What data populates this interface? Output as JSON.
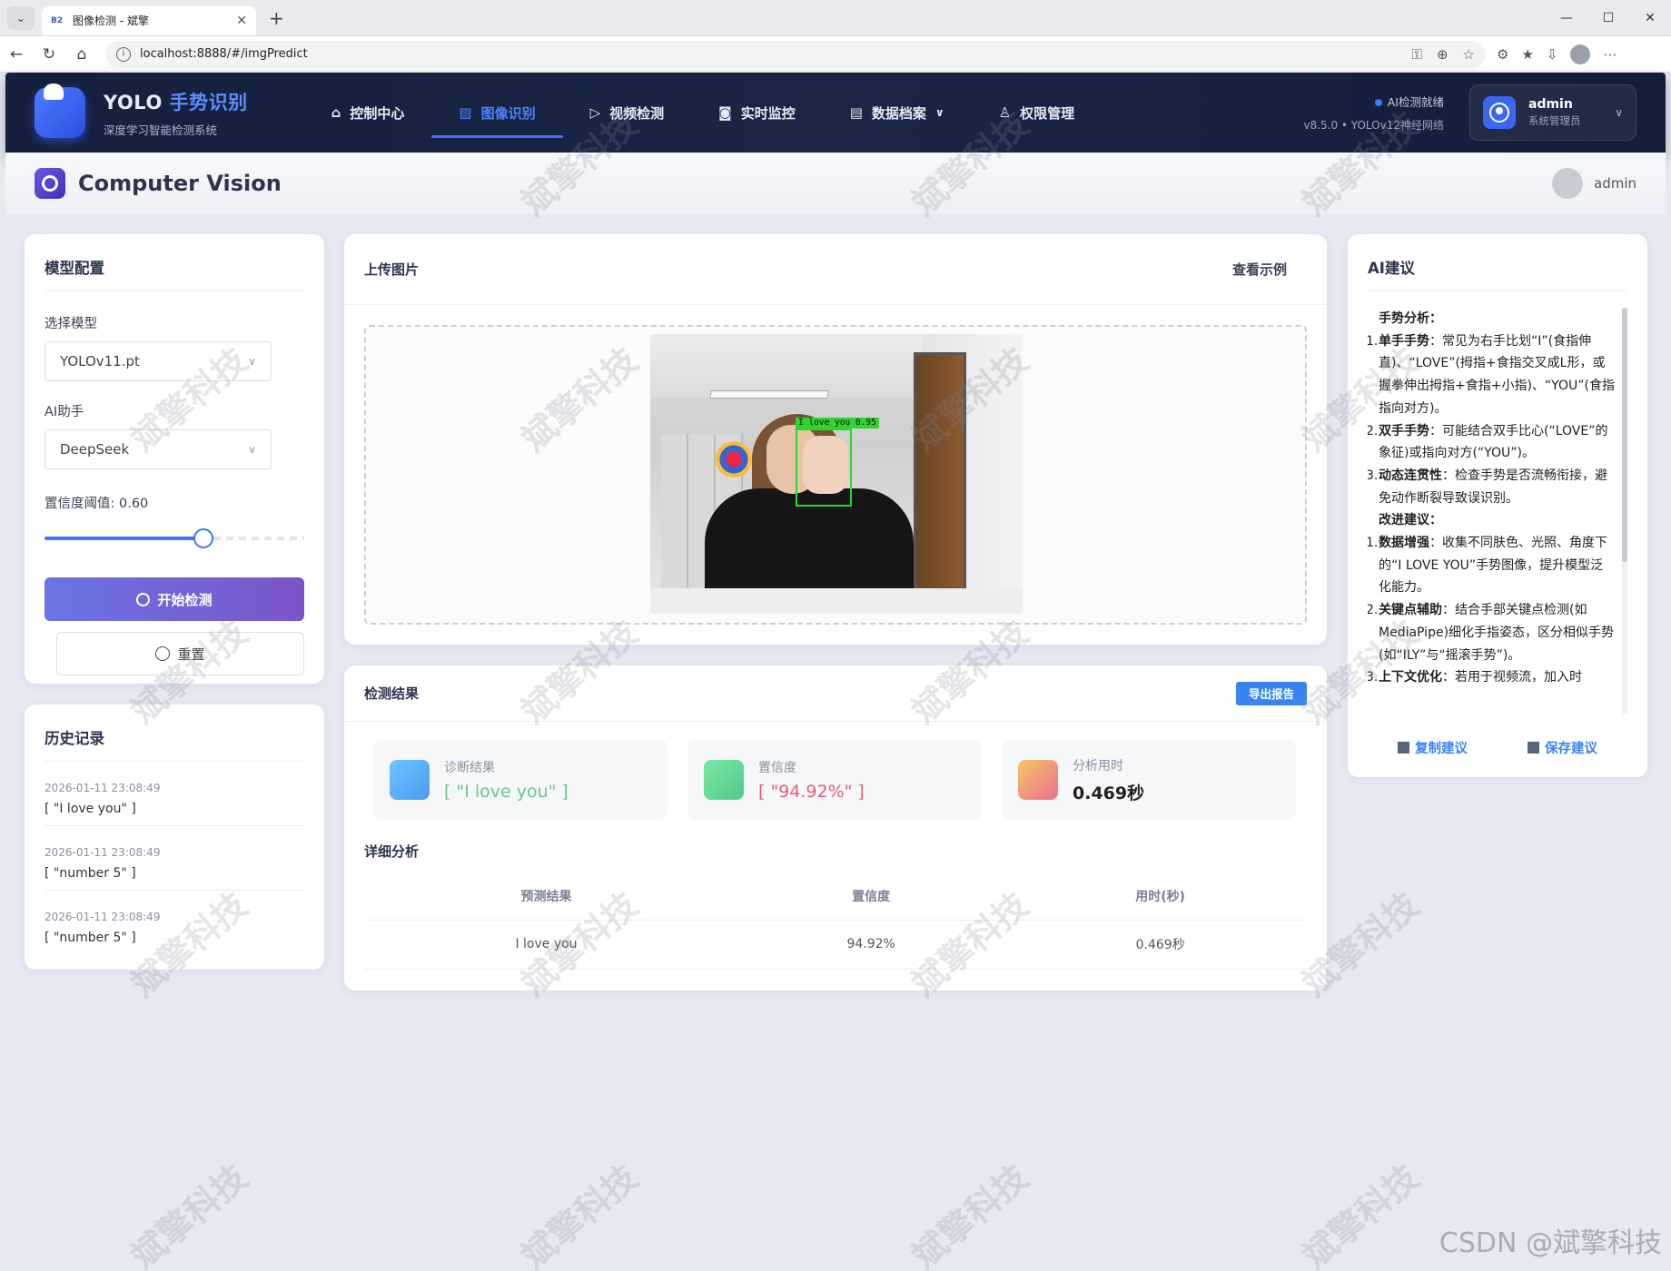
{
  "browser": {
    "tab_title": "图像检测 - 斌擎",
    "favicon_text": "B2",
    "url": "localhost:8888/#/imgPredict"
  },
  "header": {
    "brand_prefix": "YOLO",
    "brand_highlight": "手势识别",
    "brand_sub": "深度学习智能检测系统",
    "nav": [
      {
        "label": "控制中心",
        "icon": "home-icon"
      },
      {
        "label": "图像识别",
        "icon": "image-icon",
        "active": true
      },
      {
        "label": "视频检测",
        "icon": "play-icon"
      },
      {
        "label": "实时监控",
        "icon": "camera-icon"
      },
      {
        "label": "数据档案",
        "icon": "document-icon",
        "has_dropdown": true
      },
      {
        "label": "权限管理",
        "icon": "user-icon"
      }
    ],
    "status": "AI检测就绪",
    "version": "v8.5.0 • YOLOv12神经网络",
    "user_name": "admin",
    "user_role": "系统管理员"
  },
  "subheader": {
    "title": "Computer Vision",
    "user": "admin"
  },
  "config": {
    "title": "模型配置",
    "model_label": "选择模型",
    "model_value": "YOLOv11.pt",
    "assistant_label": "AI助手",
    "assistant_value": "DeepSeek",
    "threshold_label": "置信度阈值: 0.60",
    "threshold_value": 0.6,
    "start_button": "开始检测",
    "reset_button": "重置"
  },
  "history": {
    "title": "历史记录",
    "items": [
      {
        "time": "2026-01-11 23:08:49",
        "value": "[ \"I love you\" ]"
      },
      {
        "time": "2026-01-11 23:08:49",
        "value": "[ \"number 5\" ]"
      },
      {
        "time": "2026-01-11 23:08:49",
        "value": "[ \"number 5\" ]"
      }
    ]
  },
  "upload": {
    "title": "上传图片",
    "example_link": "查看示例",
    "detection_label": "I love you 0.95"
  },
  "results": {
    "title": "检测结果",
    "export_button": "导出报告",
    "stats": [
      {
        "label": "诊断结果",
        "value": "[ \"I love you\" ]",
        "color": "#67c987"
      },
      {
        "label": "置信度",
        "value": "[ \"94.92%\" ]",
        "color": "#e0607a"
      },
      {
        "label": "分析用时",
        "value": "0.469秒",
        "color": "#222222"
      }
    ],
    "detail_title": "详细分析",
    "columns": [
      "预测结果",
      "置信度",
      "用时(秒)"
    ],
    "rows": [
      [
        "I love you",
        "94.92%",
        "0.469秒"
      ]
    ]
  },
  "ai": {
    "title": "AI建议",
    "lines": [
      {
        "bold": "手势分析：",
        "text": "",
        "num": ""
      },
      {
        "bold": "单手手势",
        "text": "：常见为右手比划“I”(食指伸直)、“LOVE”(拇指+食指交叉成L形，或握拳伸出拇指+食指+小指)、“YOU”(食指指向对方)。",
        "num": "1."
      },
      {
        "bold": "双手手势",
        "text": "：可能结合双手比心(“LOVE”的象征)或指向对方(“YOU”)。",
        "num": "2."
      },
      {
        "bold": "动态连贯性",
        "text": "：检查手势是否流畅衔接，避免动作断裂导致误识别。",
        "num": "3."
      },
      {
        "bold": "改进建议：",
        "text": "",
        "num": ""
      },
      {
        "bold": "数据增强",
        "text": "：收集不同肤色、光照、角度下的“I LOVE YOU”手势图像，提升模型泛化能力。",
        "num": "1."
      },
      {
        "bold": "关键点辅助",
        "text": "：结合手部关键点检测(如MediaPipe)细化手指姿态，区分相似手势(如“ILY”与“摇滚手势”)。",
        "num": "2."
      },
      {
        "bold": "上下文优化",
        "text": "：若用于视频流，加入时",
        "num": "3."
      }
    ],
    "copy_button": "复制建议",
    "save_button": "保存建议"
  },
  "watermark": "斌擎科技",
  "footer_mark": "CSDN @斌擎科技",
  "colors": {
    "accent": "#3b74ff",
    "header_bg": "#15203d",
    "primary_gradient_start": "#6a74e6",
    "primary_gradient_end": "#7b55c8"
  }
}
